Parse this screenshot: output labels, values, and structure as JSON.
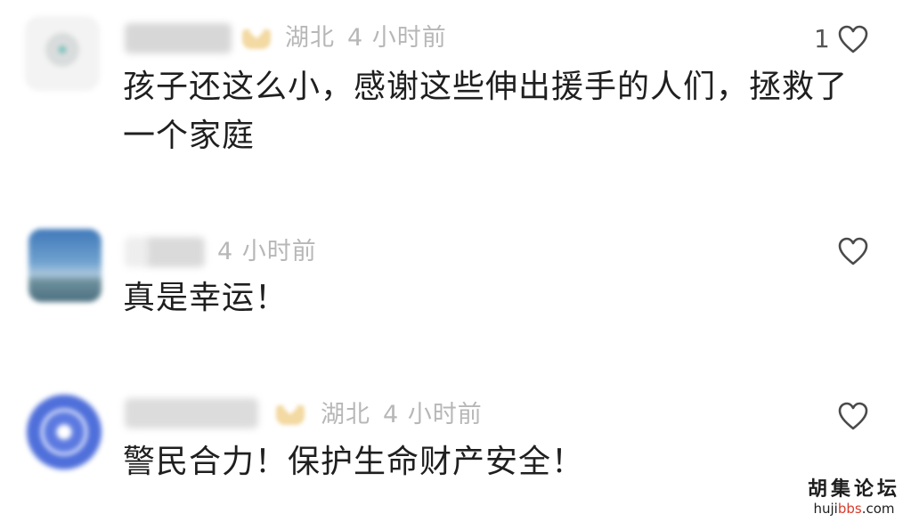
{
  "comments": [
    {
      "location": "湖北",
      "time": "4 小时前",
      "text": "孩子还这么小，感谢这些伸出援手的人们，拯救了一个家庭",
      "likes": "1",
      "has_badge": true
    },
    {
      "location": "",
      "time": "4 小时前",
      "text": "真是幸运！",
      "likes": "",
      "has_badge": false
    },
    {
      "location": "湖北",
      "time": "4 小时前",
      "text": "警民合力！保护生命财产安全！",
      "likes": "",
      "has_badge": true
    }
  ],
  "watermark": {
    "title": "胡集论坛",
    "url_prefix": "huji",
    "url_highlight": "bbs",
    "url_suffix": ".com"
  },
  "icons": {
    "like": "heart-outline-icon",
    "badge": "member-badge-icon"
  },
  "colors": {
    "meta_text": "#b7b7b7",
    "body_text": "#1f1f1f",
    "watermark_accent": "#d93a2b"
  }
}
